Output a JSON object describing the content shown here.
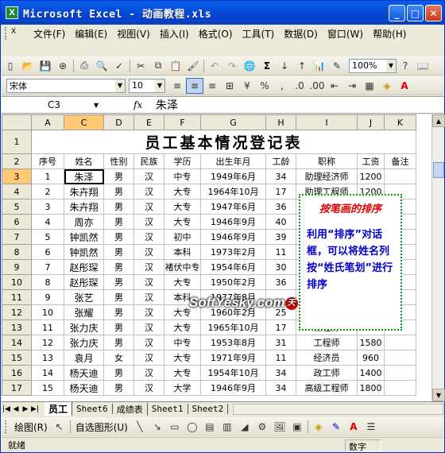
{
  "window": {
    "title": "Microsoft Excel - 动画教程.xls"
  },
  "menu": [
    "文件(F)",
    "编辑(E)",
    "视图(V)",
    "插入(I)",
    "格式(O)",
    "工具(T)",
    "数据(D)",
    "窗口(W)",
    "帮助(H)"
  ],
  "toolbar": {
    "zoom": "100%",
    "font_name": "宋体",
    "font_size": "10"
  },
  "formula_bar": {
    "name_box": "C3",
    "fx": "fx",
    "value": "朱泽"
  },
  "columns": [
    "A",
    "C",
    "D",
    "E",
    "F",
    "G",
    "H",
    "I",
    "J",
    "K"
  ],
  "selected_column": "C",
  "selected_row": "3",
  "sheet": {
    "title": "员工基本情况登记表",
    "headers": [
      "序号",
      "姓名",
      "性别",
      "民族",
      "学历",
      "出生年月",
      "工龄",
      "职称",
      "工资",
      "备注"
    ],
    "rows": [
      {
        "r": "3",
        "cells": [
          "1",
          "朱泽",
          "男",
          "汉",
          "中专",
          "1949年6月",
          "34",
          "助理经济师",
          "1200",
          ""
        ]
      },
      {
        "r": "4",
        "cells": [
          "2",
          "朱卉翔",
          "男",
          "汉",
          "大专",
          "1964年10月",
          "17",
          "助理工程师",
          "1200",
          ""
        ]
      },
      {
        "r": "5",
        "cells": [
          "3",
          "朱卉翔",
          "男",
          "汉",
          "大专",
          "1947年6月",
          "36",
          "",
          "",
          ""
        ]
      },
      {
        "r": "6",
        "cells": [
          "4",
          "周亦",
          "男",
          "汉",
          "大专",
          "1946年9月",
          "40",
          "",
          "",
          ""
        ]
      },
      {
        "r": "7",
        "cells": [
          "5",
          "钟凯然",
          "男",
          "汉",
          "初中",
          "1946年9月",
          "39",
          "",
          "",
          ""
        ]
      },
      {
        "r": "8",
        "cells": [
          "6",
          "钟凯然",
          "男",
          "汉",
          "本科",
          "1973年2月",
          "11",
          "",
          "",
          ""
        ]
      },
      {
        "r": "9",
        "cells": [
          "7",
          "赵彤琛",
          "男",
          "汉",
          "褚伏中专",
          "1954年6月",
          "30",
          "",
          "",
          ""
        ]
      },
      {
        "r": "10",
        "cells": [
          "8",
          "赵彤琛",
          "男",
          "汉",
          "大专",
          "1950年2月",
          "36",
          "",
          "",
          ""
        ]
      },
      {
        "r": "11",
        "cells": [
          "9",
          "张艺",
          "男",
          "汉",
          "本科",
          "1977年8月",
          "",
          "",
          "",
          ""
        ]
      },
      {
        "r": "12",
        "cells": [
          "10",
          "张耀",
          "男",
          "汉",
          "大专",
          "1960年2月",
          "25",
          "",
          "",
          ""
        ]
      },
      {
        "r": "13",
        "cells": [
          "11",
          "张力庆",
          "男",
          "汉",
          "大专",
          "1965年10月",
          "17",
          "工程师",
          "1580",
          ""
        ]
      },
      {
        "r": "14",
        "cells": [
          "12",
          "张力庆",
          "男",
          "汉",
          "中专",
          "1953年8月",
          "31",
          "工程师",
          "1580",
          ""
        ]
      },
      {
        "r": "15",
        "cells": [
          "13",
          "袁月",
          "女",
          "汉",
          "大专",
          "1971年9月",
          "11",
          "经济员",
          "960",
          ""
        ]
      },
      {
        "r": "16",
        "cells": [
          "14",
          "杨天迪",
          "男",
          "汉",
          "大专",
          "1954年10月",
          "34",
          "政工师",
          "1400",
          ""
        ]
      },
      {
        "r": "17",
        "cells": [
          "15",
          "杨天迪",
          "男",
          "汉",
          "大学",
          "1946年9月",
          "34",
          "高级工程师",
          "1800",
          ""
        ]
      }
    ]
  },
  "callout": {
    "heading": "按笔画的排序",
    "body": "利用“排序”对话框，可以将姓名列按“姓氏笔划”进行排序"
  },
  "watermark": {
    "text": "SoftYesky.com",
    "dot": "天"
  },
  "tabs": [
    "员工",
    "Sheet6",
    "成绩表",
    "Sheet1",
    "Sheet2"
  ],
  "active_tab": "员工",
  "drawing": {
    "draw_label": "绘图(R)",
    "autoshapes_label": "自选图形(U)"
  },
  "status": {
    "ready": "就绪",
    "mode": "数字"
  }
}
